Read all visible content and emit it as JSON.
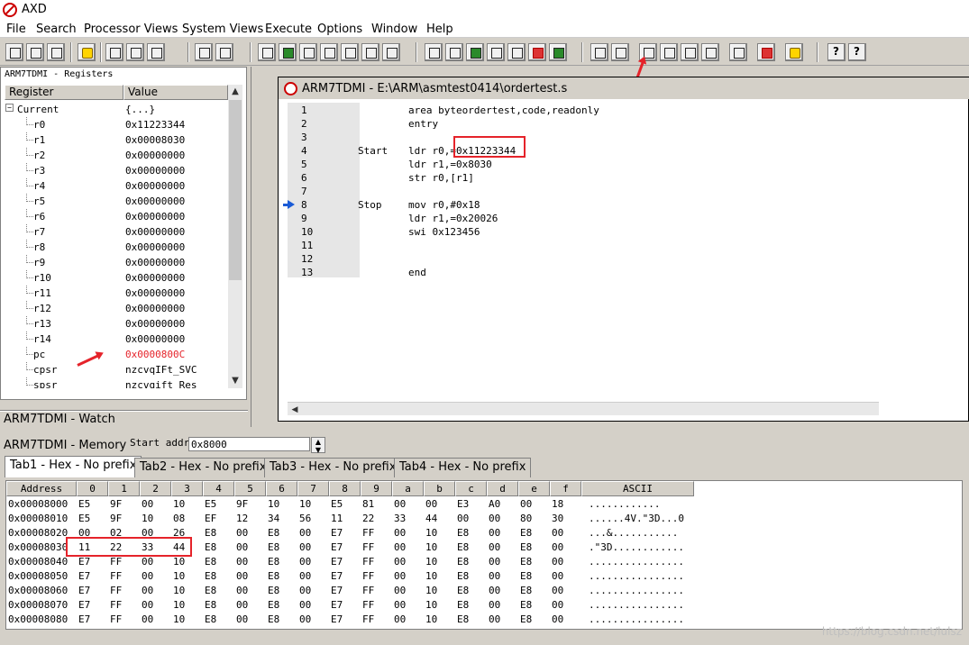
{
  "app": {
    "title": "AXD"
  },
  "menu": [
    "File",
    "Search",
    "Processor Views",
    "System Views",
    "Execute",
    "Options",
    "Window",
    "Help"
  ],
  "registers": {
    "caption": "ARM7TDMI - Registers",
    "col_register": "Register",
    "col_value": "Value",
    "group": {
      "name": "Current",
      "value": "{...}"
    },
    "rows": [
      {
        "name": "r0",
        "value": "0x11223344"
      },
      {
        "name": "r1",
        "value": "0x00008030"
      },
      {
        "name": "r2",
        "value": "0x00000000"
      },
      {
        "name": "r3",
        "value": "0x00000000"
      },
      {
        "name": "r4",
        "value": "0x00000000"
      },
      {
        "name": "r5",
        "value": "0x00000000"
      },
      {
        "name": "r6",
        "value": "0x00000000"
      },
      {
        "name": "r7",
        "value": "0x00000000"
      },
      {
        "name": "r8",
        "value": "0x00000000"
      },
      {
        "name": "r9",
        "value": "0x00000000"
      },
      {
        "name": "r10",
        "value": "0x00000000"
      },
      {
        "name": "r11",
        "value": "0x00000000"
      },
      {
        "name": "r12",
        "value": "0x00000000"
      },
      {
        "name": "r13",
        "value": "0x00000000"
      },
      {
        "name": "r14",
        "value": "0x00000000"
      },
      {
        "name": "pc",
        "value": "0x0000800C"
      },
      {
        "name": "cpsr",
        "value": "nzcvqIFt_SVC"
      },
      {
        "name": "spsr",
        "value": "nzcvqift_Res"
      }
    ],
    "changed_color": "#e5232a"
  },
  "watch": {
    "caption": "ARM7TDMI - Watch"
  },
  "editor": {
    "title": "ARM7TDMI - E:\\ARM\\asmtest0414\\ordertest.s",
    "lines": [
      {
        "n": "1",
        "label": "",
        "code": "area byteordertest,code,readonly"
      },
      {
        "n": "2",
        "label": "",
        "code": "entry"
      },
      {
        "n": "3",
        "label": "",
        "code": ""
      },
      {
        "n": "4",
        "label": "Start",
        "code": "ldr r0,=0x11223344"
      },
      {
        "n": "5",
        "label": "",
        "code": "ldr r1,=0x8030"
      },
      {
        "n": "6",
        "label": "",
        "code": "str r0,[r1]"
      },
      {
        "n": "7",
        "label": "",
        "code": ""
      },
      {
        "n": "8",
        "label": "Stop",
        "code": "mov r0,#0x18"
      },
      {
        "n": "9",
        "label": "",
        "code": "ldr r1,=0x20026"
      },
      {
        "n": "10",
        "label": "",
        "code": "swi 0x123456"
      },
      {
        "n": "11",
        "label": "",
        "code": ""
      },
      {
        "n": "12",
        "label": "",
        "code": ""
      },
      {
        "n": "13",
        "label": "",
        "code": "end"
      }
    ],
    "current_line": "8"
  },
  "memory": {
    "caption": "ARM7TDMI - Memory",
    "start_label": "Start addr",
    "start_value": "0x8000",
    "tabs": [
      "Tab1 - Hex - No prefix",
      "Tab2 - Hex - No prefix",
      "Tab3 - Hex - No prefix",
      "Tab4 - Hex - No prefix"
    ],
    "columns": [
      "Address",
      "0",
      "1",
      "2",
      "3",
      "4",
      "5",
      "6",
      "7",
      "8",
      "9",
      "a",
      "b",
      "c",
      "d",
      "e",
      "f",
      "ASCII"
    ],
    "rows": [
      {
        "addr": "0x00008000",
        "bytes": [
          "E5",
          "9F",
          "00",
          "10",
          "E5",
          "9F",
          "10",
          "10",
          "E5",
          "81",
          "00",
          "00",
          "E3",
          "A0",
          "00",
          "18"
        ],
        "ascii": "............"
      },
      {
        "addr": "0x00008010",
        "bytes": [
          "E5",
          "9F",
          "10",
          "08",
          "EF",
          "12",
          "34",
          "56",
          "11",
          "22",
          "33",
          "44",
          "00",
          "00",
          "80",
          "30"
        ],
        "ascii": "......4V.\"3D...0"
      },
      {
        "addr": "0x00008020",
        "bytes": [
          "00",
          "02",
          "00",
          "26",
          "E8",
          "00",
          "E8",
          "00",
          "E7",
          "FF",
          "00",
          "10",
          "E8",
          "00",
          "E8",
          "00"
        ],
        "ascii": "...&..........."
      },
      {
        "addr": "0x00008030",
        "bytes": [
          "11",
          "22",
          "33",
          "44",
          "E8",
          "00",
          "E8",
          "00",
          "E7",
          "FF",
          "00",
          "10",
          "E8",
          "00",
          "E8",
          "00"
        ],
        "ascii": ".\"3D............"
      },
      {
        "addr": "0x00008040",
        "bytes": [
          "E7",
          "FF",
          "00",
          "10",
          "E8",
          "00",
          "E8",
          "00",
          "E7",
          "FF",
          "00",
          "10",
          "E8",
          "00",
          "E8",
          "00"
        ],
        "ascii": "................"
      },
      {
        "addr": "0x00008050",
        "bytes": [
          "E7",
          "FF",
          "00",
          "10",
          "E8",
          "00",
          "E8",
          "00",
          "E7",
          "FF",
          "00",
          "10",
          "E8",
          "00",
          "E8",
          "00"
        ],
        "ascii": "................"
      },
      {
        "addr": "0x00008060",
        "bytes": [
          "E7",
          "FF",
          "00",
          "10",
          "E8",
          "00",
          "E8",
          "00",
          "E7",
          "FF",
          "00",
          "10",
          "E8",
          "00",
          "E8",
          "00"
        ],
        "ascii": "................"
      },
      {
        "addr": "0x00008070",
        "bytes": [
          "E7",
          "FF",
          "00",
          "10",
          "E8",
          "00",
          "E8",
          "00",
          "E7",
          "FF",
          "00",
          "10",
          "E8",
          "00",
          "E8",
          "00"
        ],
        "ascii": "................"
      },
      {
        "addr": "0x00008080",
        "bytes": [
          "E7",
          "FF",
          "00",
          "10",
          "E8",
          "00",
          "E8",
          "00",
          "E7",
          "FF",
          "00",
          "10",
          "E8",
          "00",
          "E8",
          "00"
        ],
        "ascii": "................"
      }
    ]
  },
  "watermark": "https://blog.csdn.net/lulsz"
}
